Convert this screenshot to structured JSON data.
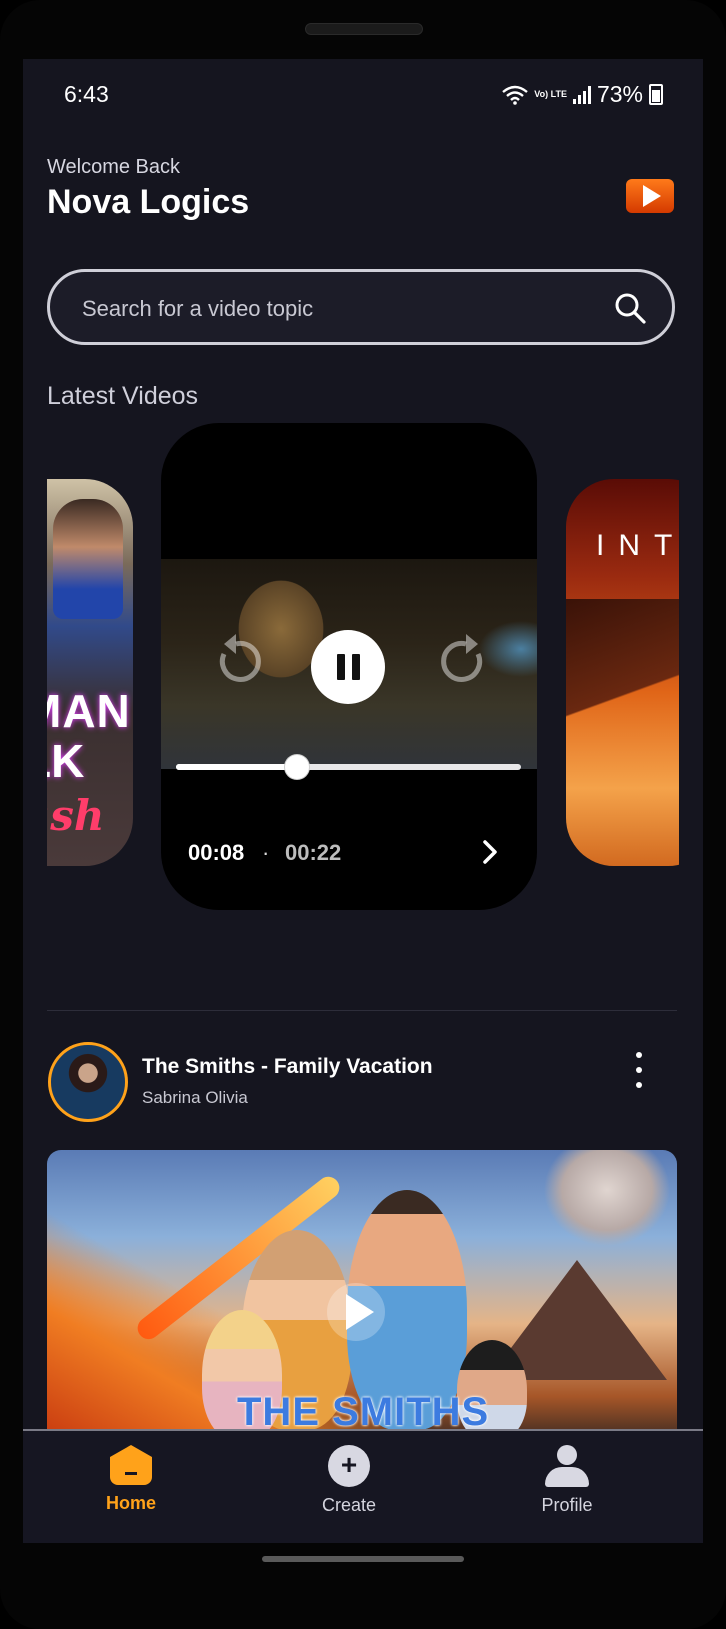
{
  "status_bar": {
    "time": "6:43",
    "network": "Vo) LTE",
    "battery": "73%"
  },
  "header": {
    "welcome": "Welcome Back",
    "username": "Nova Logics",
    "logo_icon": "play-logo-icon"
  },
  "search": {
    "placeholder": "Search for a video topic",
    "value": "",
    "icon": "search-icon"
  },
  "latest": {
    "title": "Latest Videos",
    "side_left_text": [
      "MAN",
      "LK",
      "ash"
    ],
    "side_right_text": "INT",
    "player": {
      "current_time": "00:08",
      "separator": "·",
      "total_time": "00:22",
      "progress": 0.35,
      "state": "playing"
    }
  },
  "post": {
    "title": "The Smiths - Family Vacation",
    "author": "Sabrina Olivia",
    "thumbnail_text": "THE SMITHS"
  },
  "nav": {
    "items": [
      {
        "label": "Home",
        "icon": "home-icon",
        "active": true
      },
      {
        "label": "Create",
        "icon": "plus-circle-icon",
        "active": false
      },
      {
        "label": "Profile",
        "icon": "user-icon",
        "active": false
      }
    ]
  },
  "colors": {
    "background": "#15151f",
    "accent": "#ffa21a",
    "logo": "#e8521a"
  }
}
